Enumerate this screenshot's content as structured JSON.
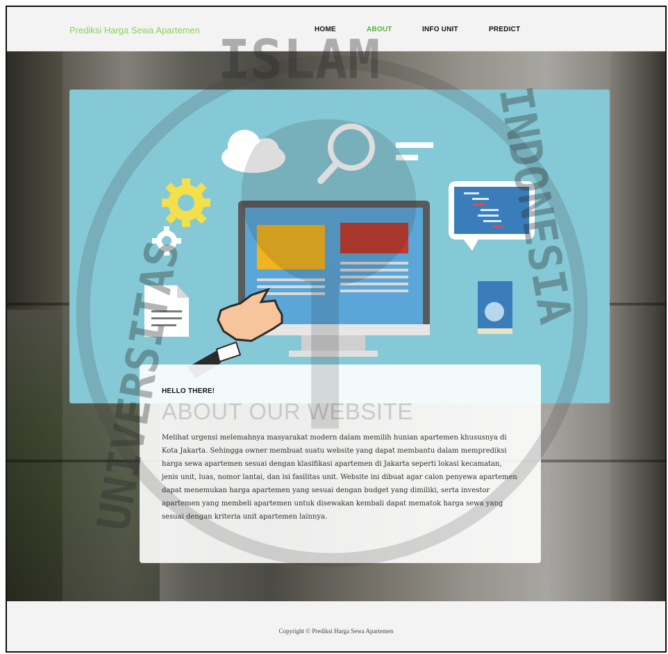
{
  "navbar": {
    "brand": "Prediksi Harga Sewa Apartemen",
    "links": [
      {
        "label": "HOME",
        "active": false
      },
      {
        "label": "ABOUT",
        "active": true
      },
      {
        "label": "INFO UNIT",
        "active": false
      },
      {
        "label": "PREDICT",
        "active": false
      }
    ]
  },
  "about": {
    "kicker": "HELLO THERE!",
    "title": "ABOUT OUR WEBSITE",
    "body": "Melihat urgensi melemahnya masyarakat modern dalam memilih hunian apartemen khususnya di Kota Jakarta. Sehingga owner membuat suatu website yang dapat membantu dalam memprediksi harga sewa apartemen sesuai dengan klasifikasi apartemen di Jakarta seperti lokasi kecamatan, jenis unit, luas, nomor lantai, dan isi fasilitas unit. Website ini dibuat agar calon penyewa apartemen dapat menemukan harga apartemen yang sesuai dengan budget yang dimiliki, serta investor apartemen yang membeli apartemen untuk disewakan kembali dapat mematok harga sewa yang sesuai dengan kriteria unit apartemen lainnya."
  },
  "footer": {
    "copyright": "Copyright © Prediksi Harga Sewa Apartemen"
  },
  "watermark": {
    "top_text": "ISLAM",
    "left_text": "UNIVERSITAS",
    "right_text": "INDONESIA"
  },
  "colors": {
    "brand_green": "#8bcf5e",
    "active_green": "#55b33b",
    "hero_teal": "#86c9d6"
  }
}
